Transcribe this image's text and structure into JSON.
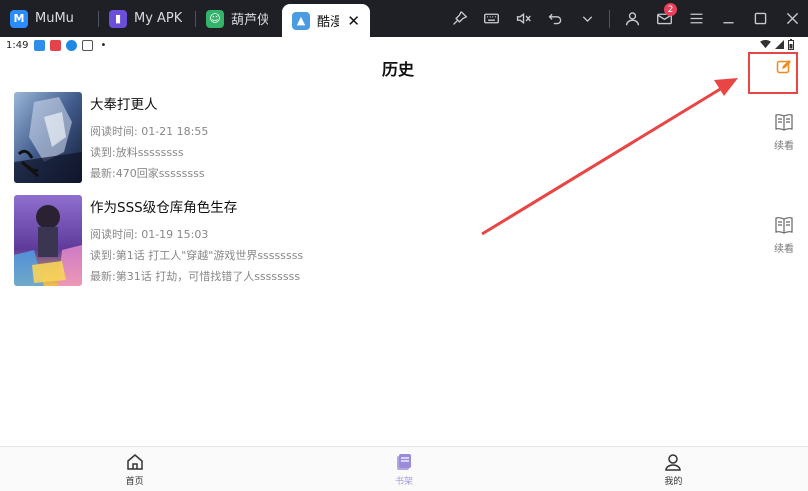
{
  "emulator": {
    "tabs": [
      {
        "label": "MuMu",
        "icon": "mumu-icon",
        "color": "#2b8cff"
      },
      {
        "label": "My APK",
        "icon": "myapk-icon",
        "color": "#6b4fd8"
      },
      {
        "label": "葫芦侠",
        "icon": "huluxia-icon",
        "color": "#34b36a"
      },
      {
        "label": "酷漫",
        "icon": "app-icon",
        "color": "#4a9be0"
      }
    ],
    "mail_badge": "2"
  },
  "statusbar": {
    "time": "1:49",
    "dot": "•"
  },
  "header": {
    "title": "历史"
  },
  "history": [
    {
      "title": "大奉打更人",
      "read_time": "阅读时间: 01-21 18:55",
      "read_to": "读到:放料ssssssss",
      "latest": "最新:470回家ssssssss",
      "resume_label": "续看"
    },
    {
      "title": "作为SSS级仓库角色生存",
      "read_time": "阅读时间: 01-19 15:03",
      "read_to": "读到:第1话 打工人\"穿越\"游戏世界ssssssss",
      "latest": "最新:第31话 打劫，可惜找错了人ssssssss",
      "resume_label": "续看"
    }
  ],
  "bottom_nav": [
    {
      "label": "首页",
      "icon": "home-icon"
    },
    {
      "label": "书架",
      "icon": "bookshelf-icon",
      "active": true
    },
    {
      "label": "我的",
      "icon": "profile-icon"
    }
  ],
  "colors": {
    "accent": "#f08a1c",
    "annotation": "#e84545",
    "nav_active": "#a99bdc"
  }
}
